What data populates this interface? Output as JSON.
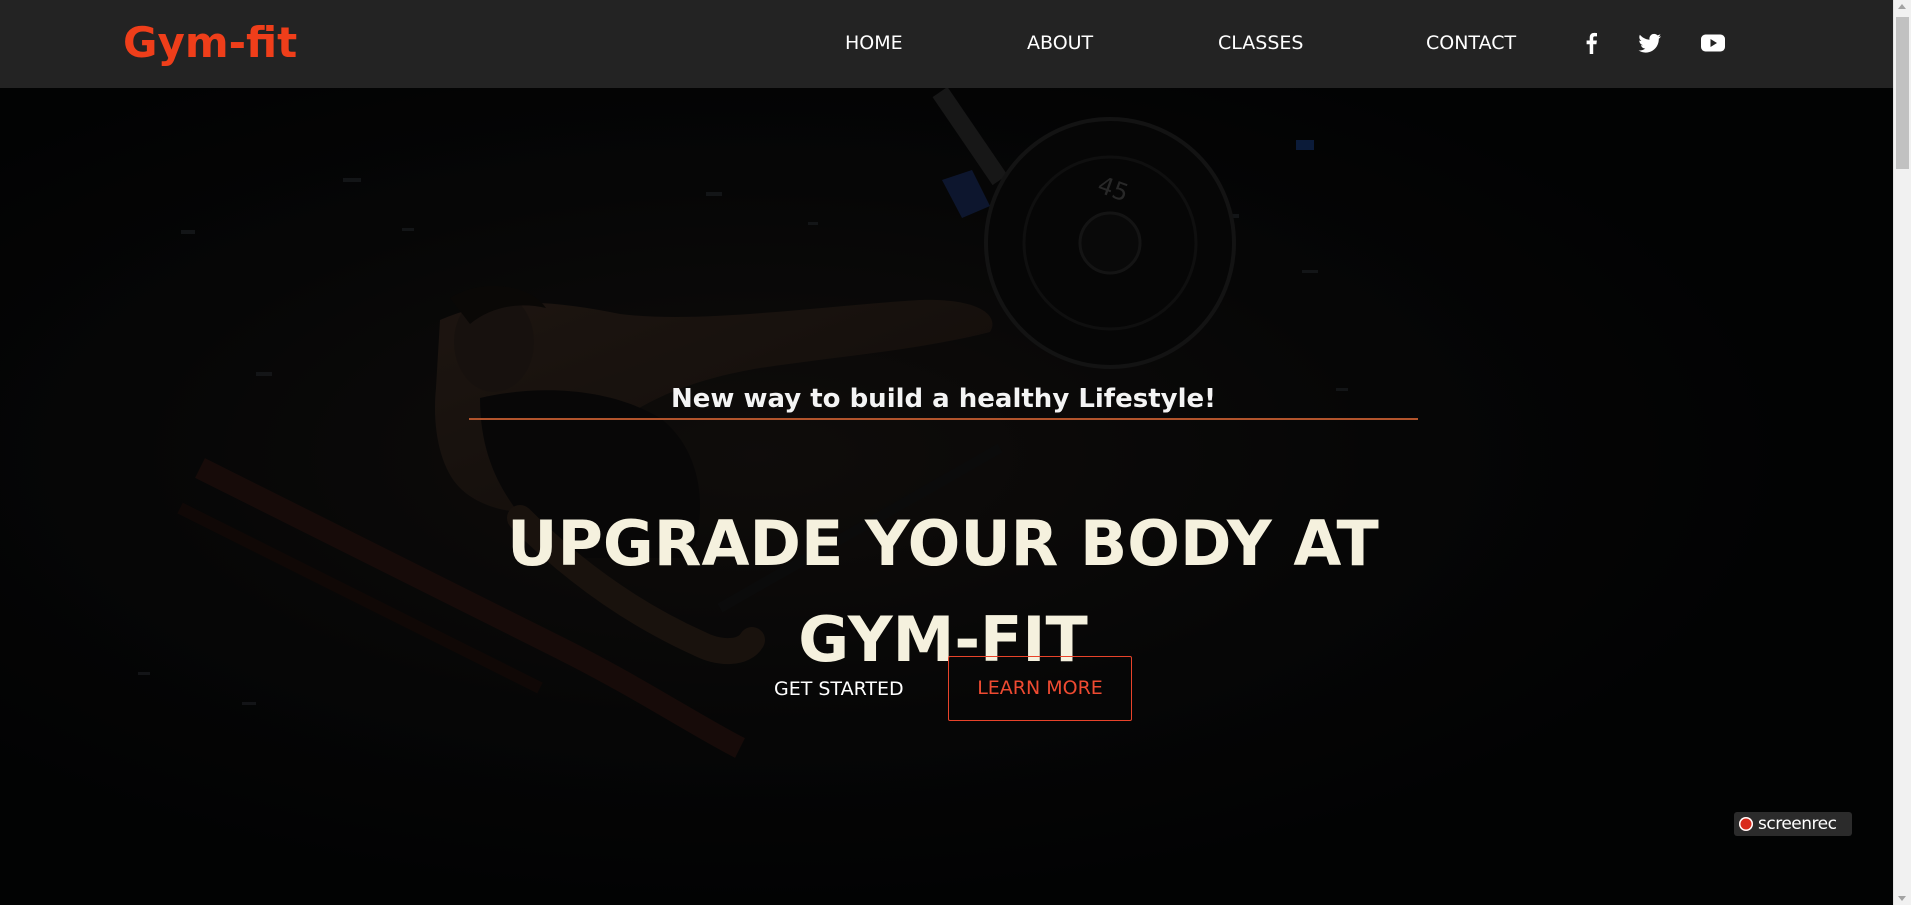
{
  "brand": {
    "logo_text": "Gym-fit",
    "accent_color": "#ef3e1a",
    "text_color": "#f5f1de"
  },
  "nav": {
    "items": [
      {
        "label": "HOME"
      },
      {
        "label": "ABOUT"
      },
      {
        "label": "CLASSES"
      },
      {
        "label": "CONTACT"
      }
    ],
    "social_icons": [
      "facebook-icon",
      "twitter-icon",
      "youtube-icon"
    ]
  },
  "hero": {
    "tagline": "New way to build a healthy Lifestyle!",
    "headline": "UPGRADE YOUR BODY AT GYM-FIT",
    "primary_cta": "GET STARTED",
    "secondary_cta": "LEARN MORE",
    "plate_number": "45"
  },
  "overlay": {
    "recorder_label": "screenrec"
  }
}
